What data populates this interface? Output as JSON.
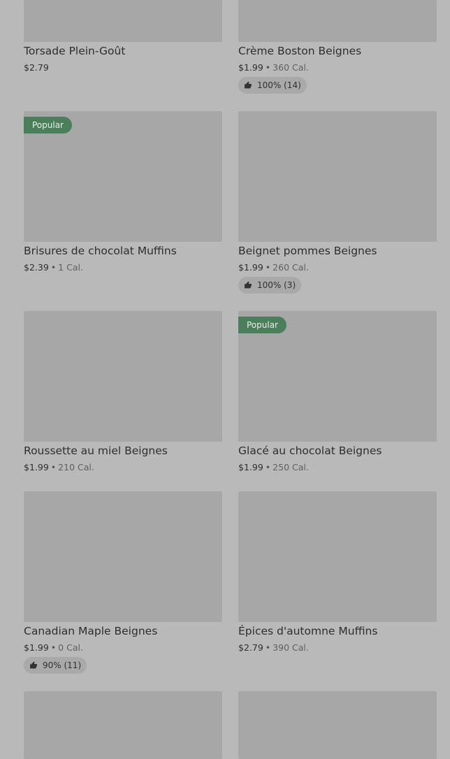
{
  "products": [
    {
      "name": "Torsade Plein-Goût",
      "price": "$2.79",
      "cal": "",
      "badge": "",
      "rating": ""
    },
    {
      "name": "Crème Boston Beignes",
      "price": "$1.99",
      "cal": "360 Cal.",
      "badge": "",
      "rating": "100% (14)"
    },
    {
      "name": "Brisures de chocolat Muffins",
      "price": "$2.39",
      "cal": "1 Cal.",
      "badge": "Popular",
      "rating": ""
    },
    {
      "name": "Beignet pommes Beignes",
      "price": "$1.99",
      "cal": "260 Cal.",
      "badge": "",
      "rating": "100% (3)"
    },
    {
      "name": "Roussette au miel Beignes",
      "price": "$1.99",
      "cal": "210 Cal.",
      "badge": "",
      "rating": ""
    },
    {
      "name": "Glacé au chocolat Beignes",
      "price": "$1.99",
      "cal": "250 Cal.",
      "badge": "Popular",
      "rating": ""
    },
    {
      "name": "Canadian Maple Beignes",
      "price": "$1.99",
      "cal": "0 Cal.",
      "badge": "",
      "rating": "90% (11)"
    },
    {
      "name": "Épices d'automne Muffins",
      "price": "$2.79",
      "cal": "390 Cal.",
      "badge": "",
      "rating": ""
    }
  ],
  "meta_separator": "•",
  "icons": {
    "rating": "thumbs-up-icon"
  }
}
